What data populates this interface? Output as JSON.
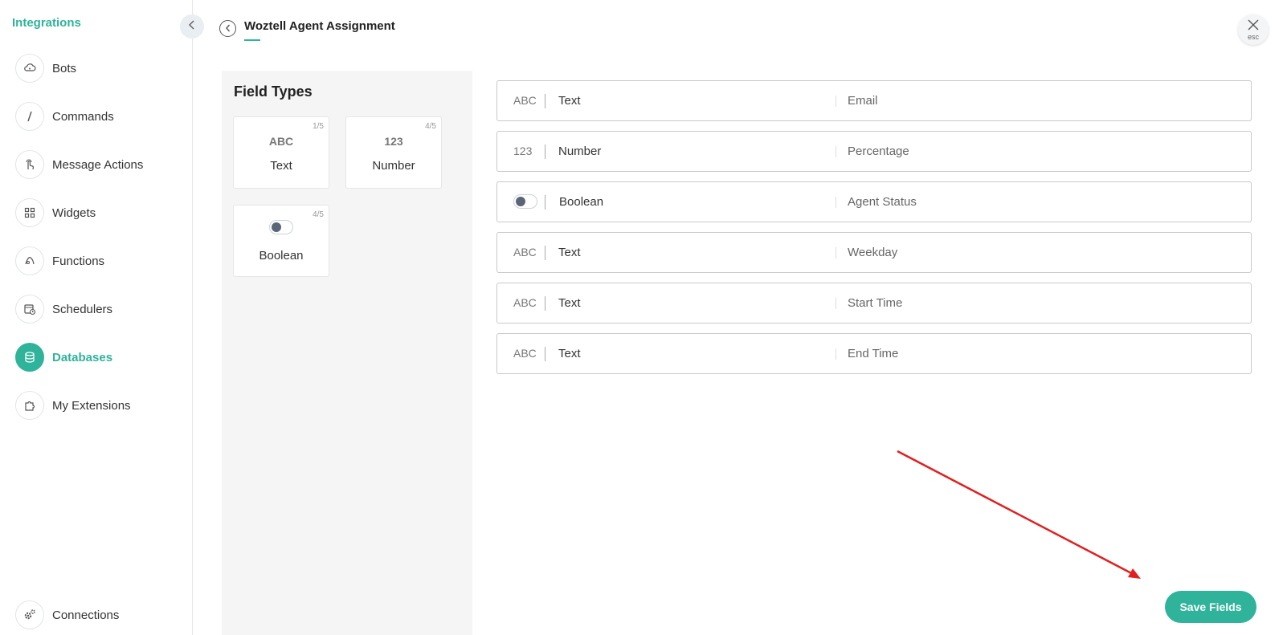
{
  "sidebar": {
    "title": "Integrations",
    "items": [
      {
        "label": "Bots",
        "icon": "bot-cloud-icon"
      },
      {
        "label": "Commands",
        "icon": "slash-icon"
      },
      {
        "label": "Message Actions",
        "icon": "pointer-hand-icon"
      },
      {
        "label": "Widgets",
        "icon": "grid-icon"
      },
      {
        "label": "Functions",
        "icon": "function-icon"
      },
      {
        "label": "Schedulers",
        "icon": "calendar-clock-icon"
      },
      {
        "label": "Databases",
        "icon": "database-icon",
        "active": true
      },
      {
        "label": "My Extensions",
        "icon": "puzzle-icon"
      }
    ],
    "footer": {
      "label": "Connections",
      "icon": "gears-icon"
    }
  },
  "header": {
    "title": "Woztell Agent Assignment",
    "close_hint": "esc"
  },
  "field_types": {
    "title": "Field Types",
    "cards": [
      {
        "symbol": "ABC",
        "label": "Text",
        "count": "1/5"
      },
      {
        "symbol": "123",
        "label": "Number",
        "count": "4/5"
      },
      {
        "symbol": "toggle",
        "label": "Boolean",
        "count": "4/5"
      }
    ]
  },
  "fields": [
    {
      "symbol": "ABC",
      "type": "Text",
      "name": "Email"
    },
    {
      "symbol": "123",
      "type": "Number",
      "name": "Percentage"
    },
    {
      "symbol": "toggle",
      "type": "Boolean",
      "name": "Agent Status"
    },
    {
      "symbol": "ABC",
      "type": "Text",
      "name": "Weekday"
    },
    {
      "symbol": "ABC",
      "type": "Text",
      "name": "Start Time"
    },
    {
      "symbol": "ABC",
      "type": "Text",
      "name": "End Time"
    }
  ],
  "actions": {
    "save_label": "Save Fields"
  },
  "colors": {
    "accent": "#2fb39a",
    "annotation_arrow": "#e02020"
  }
}
